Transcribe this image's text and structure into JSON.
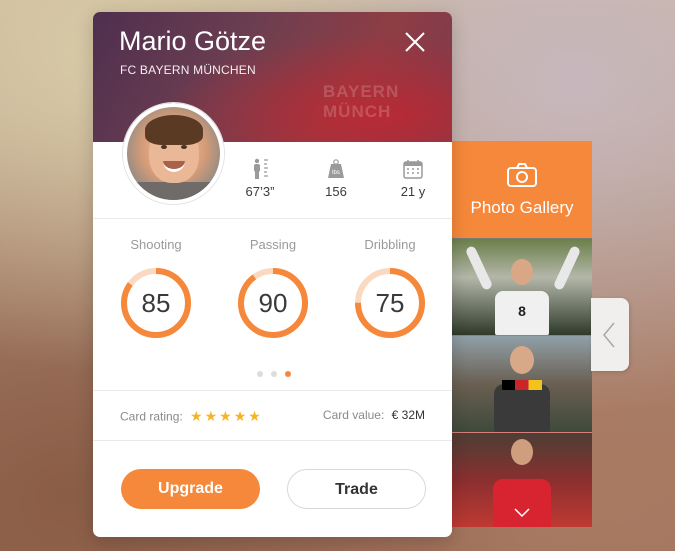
{
  "player": {
    "name": "Mario Götze",
    "club": "FC BAYERN MÜNCHEN",
    "background_text": "BAYERN MÜNCH"
  },
  "stats": [
    {
      "icon": "height-icon",
      "value": "67’3”"
    },
    {
      "icon": "weight-icon",
      "icon_text": "lbs",
      "value": "156"
    },
    {
      "icon": "calendar-icon",
      "value": "21 y"
    }
  ],
  "skills": [
    {
      "label": "Shooting",
      "value": "85",
      "level": 0.85
    },
    {
      "label": "Passing",
      "value": "90",
      "level": 0.9
    },
    {
      "label": "Dribbling",
      "value": "75",
      "level": 0.75
    }
  ],
  "pager": {
    "pages": 3,
    "active_index": 2
  },
  "rating": {
    "label": "Card rating:",
    "stars": 5,
    "stars_text": "★★★★★"
  },
  "card_value": {
    "label": "Card value:",
    "amount": "€ 32M"
  },
  "buttons": {
    "upgrade": "Upgrade",
    "trade": "Trade"
  },
  "gallery": {
    "title": "Photo Gallery",
    "photo_jersey_number": "8"
  },
  "colors": {
    "accent": "#f5883a",
    "star": "#f5b427",
    "header_overlay": "#6d3e50"
  }
}
